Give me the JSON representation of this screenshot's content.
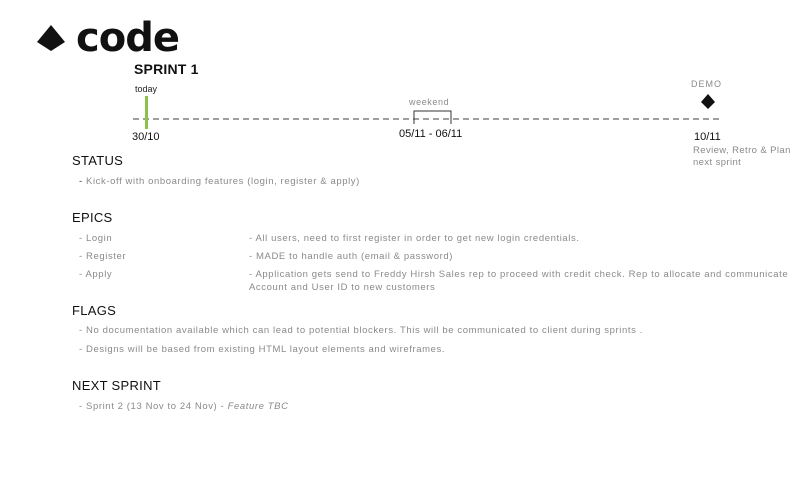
{
  "brand": {
    "logo_text": "code",
    "logo_icon": "diamond-drop-icon"
  },
  "sprint": {
    "title": "SPRINT 1"
  },
  "timeline": {
    "today_label": "today",
    "start_date": "30/10",
    "weekend_label": "weekend",
    "weekend_range": "05/11 - 06/11",
    "demo_label": "DEMO",
    "demo_date": "10/11",
    "demo_note": "Review, Retro & Plan next sprint",
    "colors": {
      "today_marker": "#8bc34a",
      "line": "#666666"
    }
  },
  "status": {
    "title": "STATUS",
    "items": [
      "Kick-off with onboarding features (login, register & apply)"
    ]
  },
  "epics": {
    "title": "EPICS",
    "items": [
      {
        "name": "Login",
        "description": "All users, need to first register in order to get new login credentials."
      },
      {
        "name": "Register",
        "description": "MADE to handle auth (email & password)"
      },
      {
        "name": "Apply",
        "description": "Application gets send to Freddy Hirsh Sales rep to proceed with credit check. Rep to allocate and communicate Account and User ID to new customers"
      }
    ]
  },
  "flags": {
    "title": "FLAGS",
    "items": [
      "No documentation available which can lead to potential blockers. This will be communicated to client during sprints .",
      "Designs will be based from existing HTML layout elements and wireframes."
    ]
  },
  "next_sprint": {
    "title": "NEXT SPRINT",
    "item_text": "Sprint 2 (13 Nov to 24 Nov) -",
    "item_italic": "Feature TBC"
  },
  "bullet": "-"
}
